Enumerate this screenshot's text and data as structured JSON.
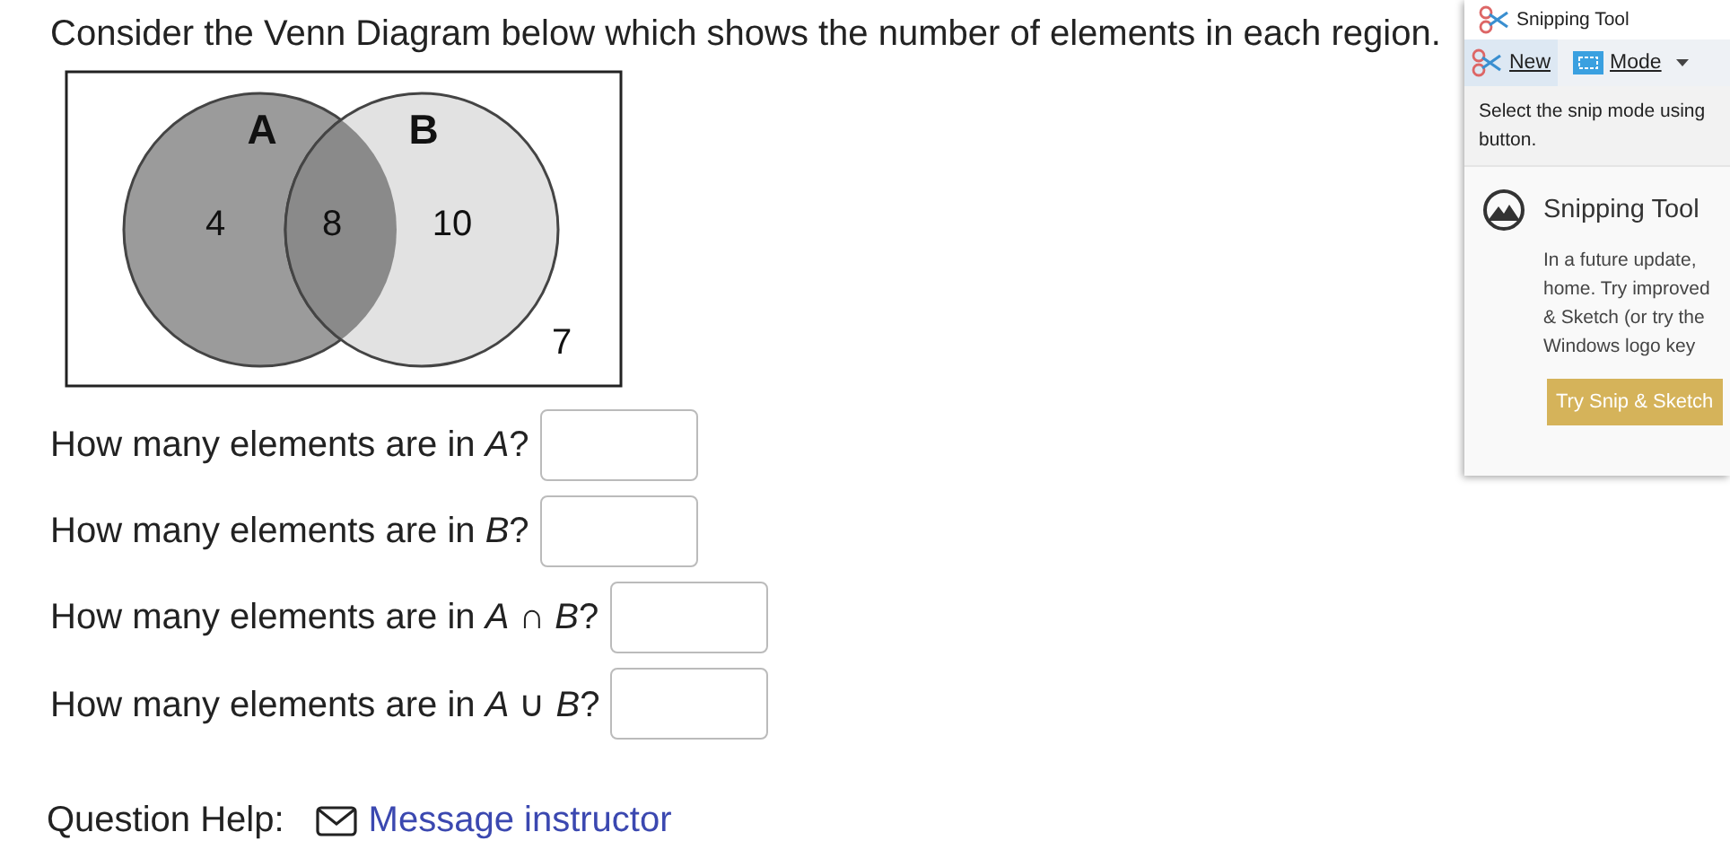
{
  "prompt": "Consider the Venn Diagram below which shows the number of elements in each region.",
  "venn": {
    "sets": [
      {
        "label": "A"
      },
      {
        "label": "B"
      }
    ],
    "regions": [
      {
        "kind": "a_only",
        "count": "4"
      },
      {
        "kind": "both",
        "count": "8"
      },
      {
        "kind": "b_only",
        "count": "10"
      },
      {
        "kind": "outside",
        "count": "7"
      }
    ]
  },
  "questions": [
    {
      "text": "How many elements are in *A*?"
    },
    {
      "text": "How many elements are in *B*?"
    },
    {
      "text": "How many elements are in *A* ∩ *B*?"
    },
    {
      "text": "How many elements are in *A* ∪ *B*?"
    }
  ],
  "help": {
    "label": "Question Help:",
    "link": "Message instructor"
  },
  "snipping_tool": {
    "title": "Snipping Tool",
    "toolbar": [
      {
        "kind": "new",
        "label": "New"
      },
      {
        "kind": "mode",
        "label": "Mode"
      }
    ],
    "hint_lines": [
      "Select the snip mode using",
      "button."
    ],
    "notice": {
      "title": "Snipping Tool",
      "lines": [
        "In a future update,",
        "home. Try improved",
        "& Sketch (or try the",
        "Windows logo key"
      ],
      "button": "Try Snip & Sketch"
    }
  }
}
